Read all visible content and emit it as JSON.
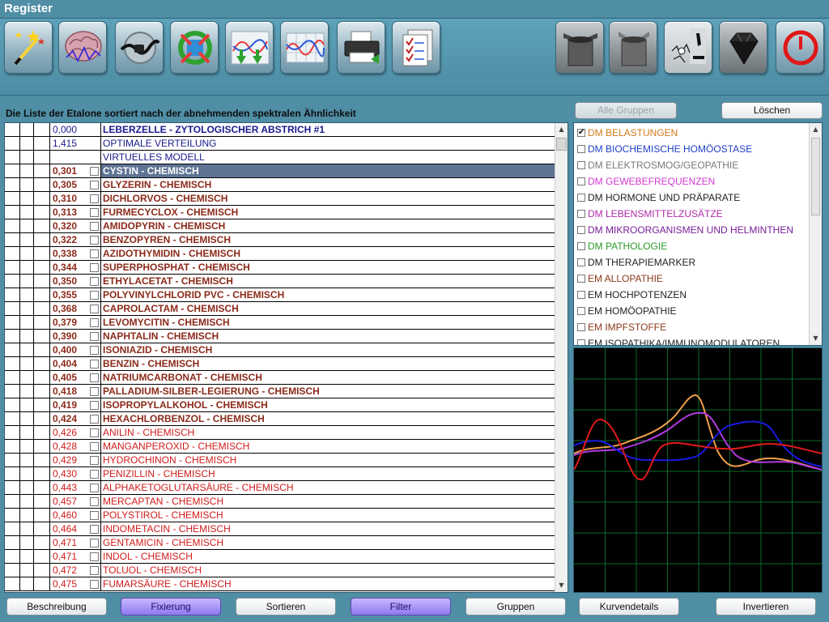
{
  "window": {
    "title": "Register"
  },
  "toolbar": {
    "buttons": [
      {
        "name": "wand-icon",
        "color": "#f5c41b"
      },
      {
        "name": "brain-icon",
        "color": "#c58a9a"
      },
      {
        "name": "cable-icon",
        "color": "#333333"
      },
      {
        "name": "cycle-icon",
        "color": "#2ea12e"
      },
      {
        "name": "graph-arrows-icon",
        "color": "#e83a3a"
      },
      {
        "name": "wave-grid-icon",
        "color": "#2a5ad8"
      },
      {
        "name": "printer-icon",
        "color": "#222222"
      },
      {
        "name": "checklist-icon",
        "color": "#c02020"
      },
      {
        "name": "container-open-icon",
        "color": "#444444"
      },
      {
        "name": "container-icon",
        "color": "#555555"
      },
      {
        "name": "microscope-icon",
        "color": "#111111"
      },
      {
        "name": "gem-icon",
        "color": "#202020"
      },
      {
        "name": "power-icon",
        "color": "#e01818"
      }
    ]
  },
  "list": {
    "title": "Die Liste der Etalone sortiert nach der abnehmenden spektralen Ähnlichkeit",
    "rows": [
      {
        "value": "0,000",
        "name": "LEBERZELLE - ZYTOLOGISCHER ABSTRICH #1",
        "style": "top first",
        "checkbox": false
      },
      {
        "value": "1,415",
        "name": "OPTIMALE VERTEILUNG",
        "style": "top",
        "checkbox": false
      },
      {
        "value": "",
        "name": "VIRTUELLES MODELL",
        "style": "top",
        "checkbox": false
      },
      {
        "value": "0,301",
        "name": "CYSTIN - CHEMISCH",
        "style": "bold sel",
        "checkbox": true
      },
      {
        "value": "0,305",
        "name": "GLYZERIN - CHEMISCH",
        "style": "bold",
        "checkbox": true
      },
      {
        "value": "0,310",
        "name": "DICHLORVOS - CHEMISCH",
        "style": "bold",
        "checkbox": true
      },
      {
        "value": "0,313",
        "name": "FURMECYCLOX - CHEMISCH",
        "style": "bold",
        "checkbox": true
      },
      {
        "value": "0,320",
        "name": "AMIDOPYRIN - CHEMISCH",
        "style": "bold",
        "checkbox": true
      },
      {
        "value": "0,322",
        "name": "BENZOPYREN - CHEMISCH",
        "style": "bold",
        "checkbox": true
      },
      {
        "value": "0,338",
        "name": "AZIDOTHYMIDIN - CHEMISCH",
        "style": "bold",
        "checkbox": true
      },
      {
        "value": "0,344",
        "name": "SUPERPHOSPHAT - CHEMISCH",
        "style": "bold",
        "checkbox": true
      },
      {
        "value": "0,350",
        "name": "ETHYLACETAT - CHEMISCH",
        "style": "bold",
        "checkbox": true
      },
      {
        "value": "0,355",
        "name": "POLYVINYLCHLORID PVC - CHEMISCH",
        "style": "bold",
        "checkbox": true
      },
      {
        "value": "0,368",
        "name": "CAPROLACTAM - CHEMISCH",
        "style": "bold",
        "checkbox": true
      },
      {
        "value": "0,379",
        "name": "LEVOMYCITIN - CHEMISCH",
        "style": "bold",
        "checkbox": true
      },
      {
        "value": "0,390",
        "name": "NAPHTALIN - CHEMISCH",
        "style": "bold",
        "checkbox": true
      },
      {
        "value": "0,400",
        "name": "ISONIAZID - CHEMISCH",
        "style": "bold",
        "checkbox": true
      },
      {
        "value": "0,404",
        "name": "BENZIN - CHEMISCH",
        "style": "bold",
        "checkbox": true
      },
      {
        "value": "0,405",
        "name": "NATRIUMCARBONAT - CHEMISCH",
        "style": "bold",
        "checkbox": true
      },
      {
        "value": "0,418",
        "name": "PALLADIUM-SILBER-LEGIERUNG - CHEMISCH",
        "style": "bold",
        "checkbox": true
      },
      {
        "value": "0,419",
        "name": "ISOPROPYLALKOHOL - CHEMISCH",
        "style": "bold",
        "checkbox": true
      },
      {
        "value": "0,424",
        "name": "HEXACHLORBENZOL - CHEMISCH",
        "style": "bold",
        "checkbox": true
      },
      {
        "value": "0,426",
        "name": "ANILIN - CHEMISCH",
        "style": "red",
        "checkbox": true
      },
      {
        "value": "0,428",
        "name": "MANGANPEROXID - CHEMISCH",
        "style": "red",
        "checkbox": true
      },
      {
        "value": "0,429",
        "name": "HYDROCHINON - CHEMISCH",
        "style": "red",
        "checkbox": true
      },
      {
        "value": "0,430",
        "name": "PENIZILLIN - CHEMISCH",
        "style": "red",
        "checkbox": true
      },
      {
        "value": "0,443",
        "name": "ALPHAKETOGLUTARSÄURE - CHEMISCH",
        "style": "red",
        "checkbox": true
      },
      {
        "value": "0,457",
        "name": "MERCAPTAN - CHEMISCH",
        "style": "red",
        "checkbox": true
      },
      {
        "value": "0,460",
        "name": "POLYSTIROL - CHEMISCH",
        "style": "red",
        "checkbox": true
      },
      {
        "value": "0,464",
        "name": "INDOMETACIN - CHEMISCH",
        "style": "red",
        "checkbox": true
      },
      {
        "value": "0,471",
        "name": "GENTAMICIN - CHEMISCH",
        "style": "red",
        "checkbox": true
      },
      {
        "value": "0,471",
        "name": "INDOL - CHEMISCH",
        "style": "red",
        "checkbox": true
      },
      {
        "value": "0,472",
        "name": "TOLUOL - CHEMISCH",
        "style": "red",
        "checkbox": true
      },
      {
        "value": "0,475",
        "name": "FUMARSÄURE - CHEMISCH",
        "style": "red",
        "checkbox": true
      }
    ]
  },
  "groups": {
    "all_groups_label": "Alle Gruppen",
    "delete_label": "Löschen",
    "items": [
      {
        "label": "DM BELASTUNGEN",
        "color": "#d27a1b",
        "checked": true
      },
      {
        "label": "DM BIOCHEMISCHE HOMÖOSTASE",
        "color": "#1f3fc9",
        "checked": false
      },
      {
        "label": "DM ELEKTROSMOG/GEOPATHIE",
        "color": "#7a7a7a",
        "checked": false
      },
      {
        "label": "DM GEWEBEFREQUENZEN",
        "color": "#d23ad2",
        "checked": false
      },
      {
        "label": "DM HORMONE UND PRÄPARATE",
        "color": "#222222",
        "checked": false
      },
      {
        "label": "DM LEBENSMITTELZUSÄTZE",
        "color": "#b02aa8",
        "checked": false
      },
      {
        "label": "DM MIKROORGANISMEN UND HELMINTHEN",
        "color": "#7a1e9a",
        "checked": false
      },
      {
        "label": "DM PATHOLOGIE",
        "color": "#2a9a2a",
        "checked": false
      },
      {
        "label": "DM THERAPIEMARKER",
        "color": "#222222",
        "checked": false
      },
      {
        "label": "EM ALLOPATHIE",
        "color": "#8b3a1a",
        "checked": false
      },
      {
        "label": "EM HOCHPOTENZEN",
        "color": "#222222",
        "checked": false
      },
      {
        "label": "EM HOMÖOPATHIE",
        "color": "#222222",
        "checked": false
      },
      {
        "label": "EM IMPFSTOFFE",
        "color": "#8b3a1a",
        "checked": false
      },
      {
        "label": "EM ISOPATHIKA/IMMUNOMODULATOREN",
        "color": "#222222",
        "checked": false
      }
    ]
  },
  "graph": {
    "colors": {
      "red": "#e01a1a",
      "blue": "#1a1ae0",
      "violet": "#b23ae0",
      "orange": "#f2a04a",
      "grid": "#0a6a2a"
    }
  },
  "bottom": {
    "beschreibung": "Beschreibung",
    "fixierung": "Fixierung",
    "sortieren": "Sortieren",
    "filter": "Filter",
    "gruppen": "Gruppen",
    "kurvendetails": "Kurvendetails",
    "invertieren": "Invertieren"
  }
}
